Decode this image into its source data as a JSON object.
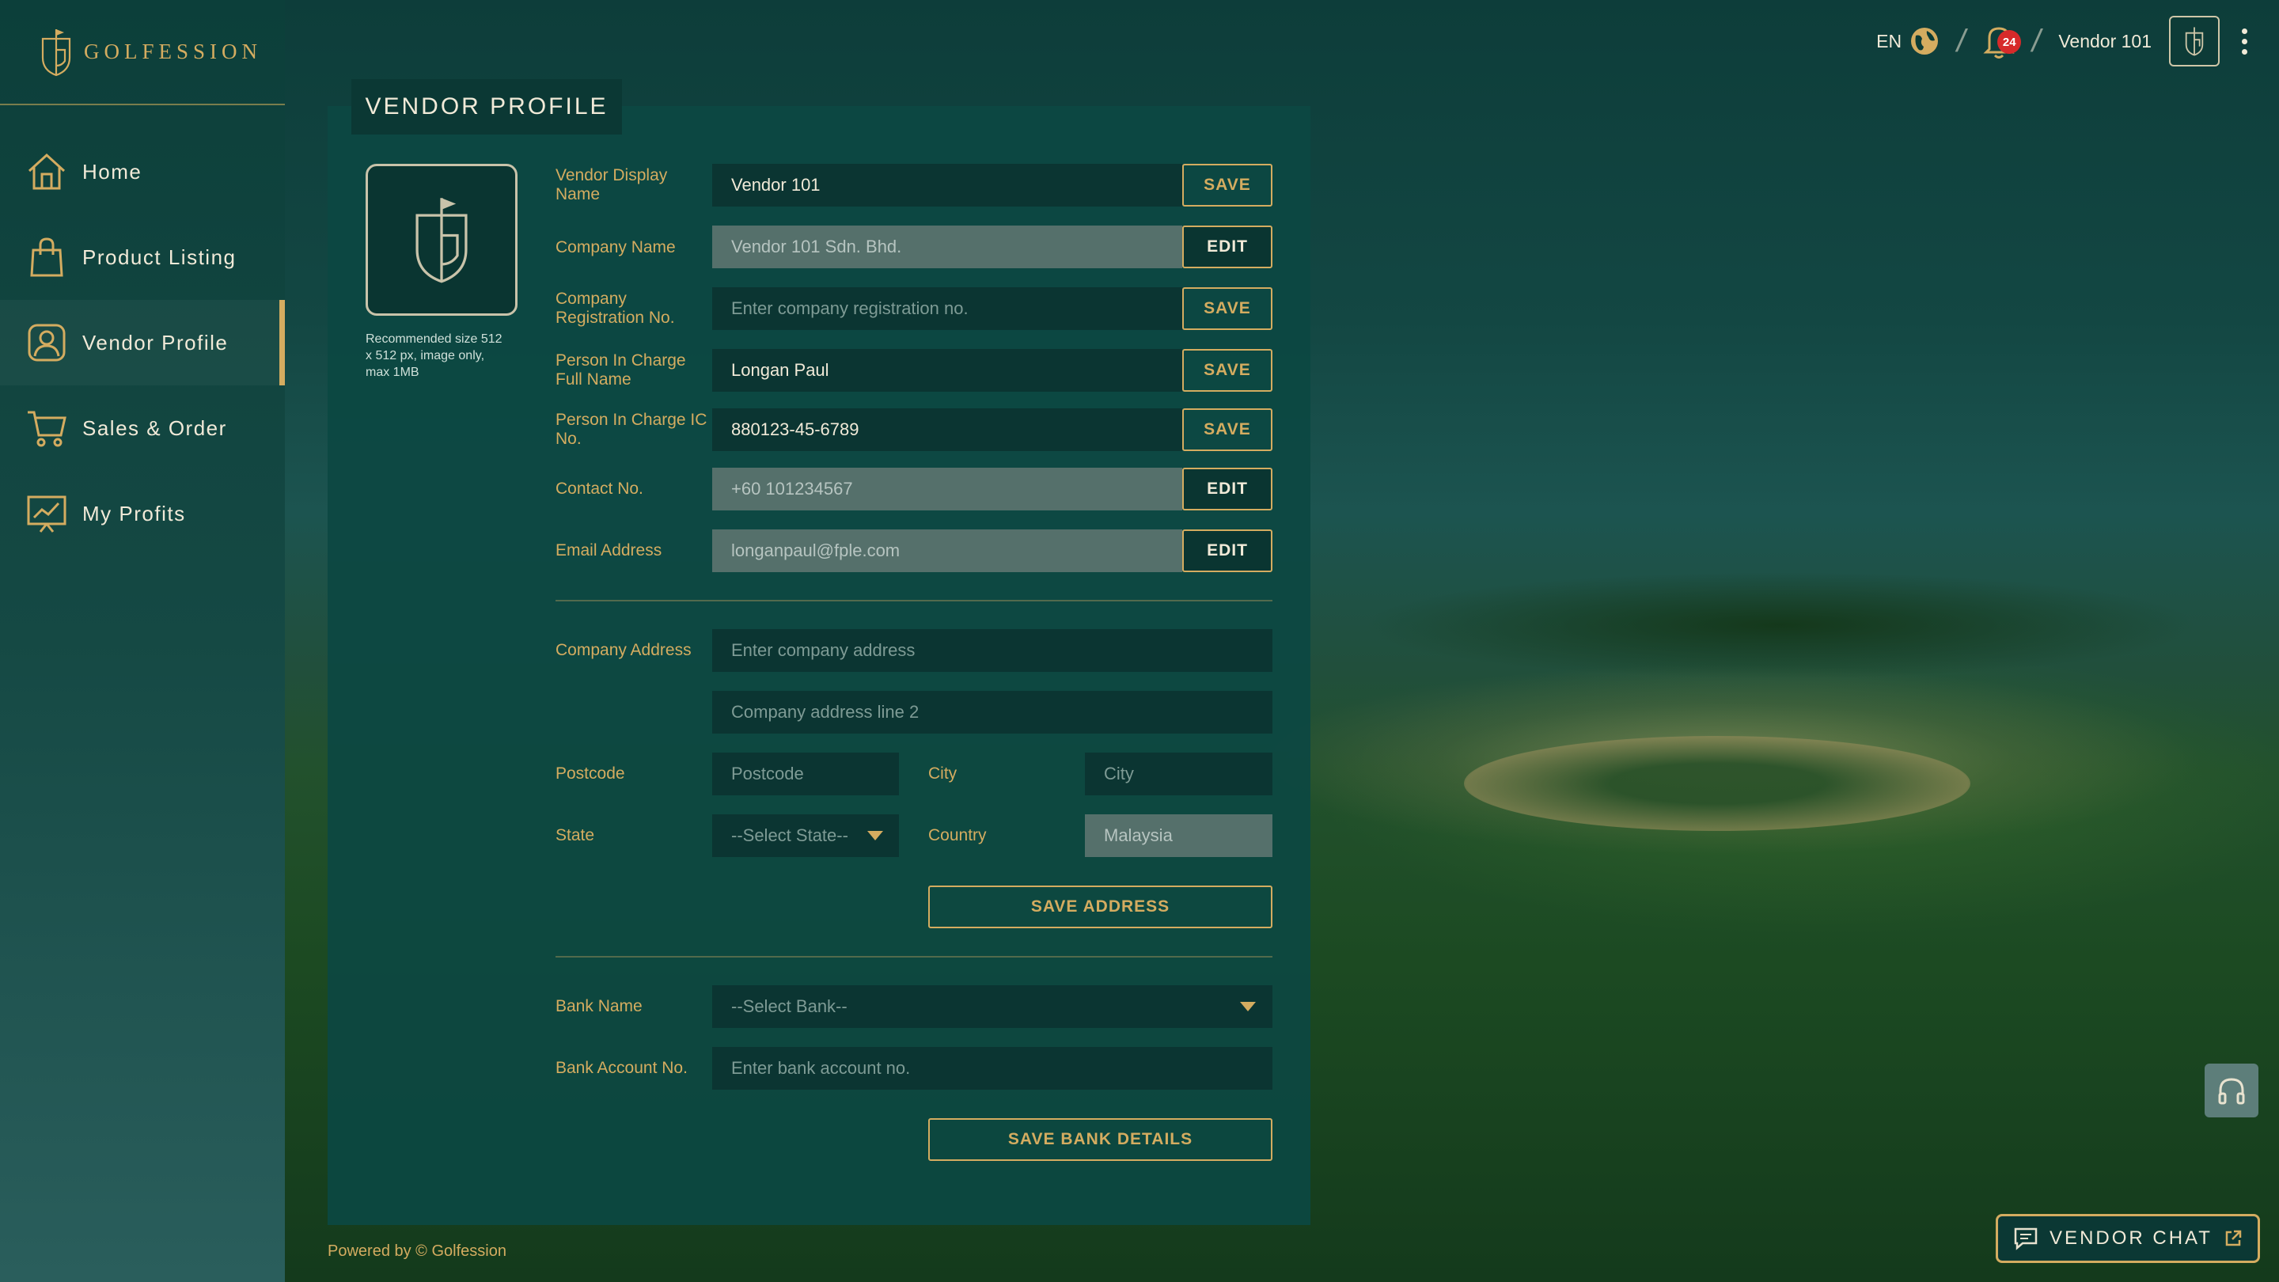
{
  "brand": {
    "name": "GOLFESSION"
  },
  "nav": [
    {
      "label": "Home",
      "icon": "home-icon"
    },
    {
      "label": "Product Listing",
      "icon": "shopping-bag-icon"
    },
    {
      "label": "Vendor Profile",
      "icon": "user-profile-icon",
      "active": true
    },
    {
      "label": "Sales & Order",
      "icon": "cart-icon"
    },
    {
      "label": "My Profits",
      "icon": "chart-icon"
    }
  ],
  "topbar": {
    "language": "EN",
    "notification_count": "24",
    "user_name": "Vendor 101"
  },
  "page": {
    "title": "VENDOR PROFILE",
    "logo_hint": "Recommended size 512 x 512 px, image only, max 1MB"
  },
  "form": {
    "display_name": {
      "label": "Vendor Display Name",
      "value": "Vendor 101",
      "button": "SAVE"
    },
    "company_name": {
      "label": "Company Name",
      "value": "Vendor 101 Sdn. Bhd.",
      "button": "EDIT"
    },
    "registration_no": {
      "label": "Company Registration No.",
      "placeholder": "Enter company registration no.",
      "button": "SAVE"
    },
    "pic_name": {
      "label": "Person In Charge Full Name",
      "value": "Longan Paul",
      "button": "SAVE"
    },
    "pic_ic": {
      "label": "Person In Charge IC No.",
      "value": "880123-45-6789",
      "button": "SAVE"
    },
    "contact_no": {
      "label": "Contact No.",
      "value": "+60 101234567",
      "button": "EDIT"
    },
    "email": {
      "label": "Email Address",
      "value": "longanpaul@fple.com",
      "button": "EDIT"
    }
  },
  "address": {
    "label": "Company Address",
    "line1_placeholder": "Enter company address",
    "line2_placeholder": "Company address line 2",
    "postcode_label": "Postcode",
    "postcode_placeholder": "Postcode",
    "city_label": "City",
    "city_placeholder": "City",
    "state_label": "State",
    "state_value": "--Select State--",
    "country_label": "Country",
    "country_value": "Malaysia",
    "save_button": "SAVE ADDRESS"
  },
  "bank": {
    "name_label": "Bank Name",
    "name_value": "--Select Bank--",
    "account_label": "Bank Account No.",
    "account_placeholder": "Enter bank account no.",
    "save_button": "SAVE BANK DETAILS"
  },
  "footer": {
    "text": "Powered by © Golfession"
  },
  "chat": {
    "label": "VENDOR CHAT"
  },
  "colors": {
    "accent": "#d4ac60",
    "panel": "#0c4842",
    "input": "#0b3532",
    "locked": "#55706b",
    "badge": "#d72a2a"
  }
}
